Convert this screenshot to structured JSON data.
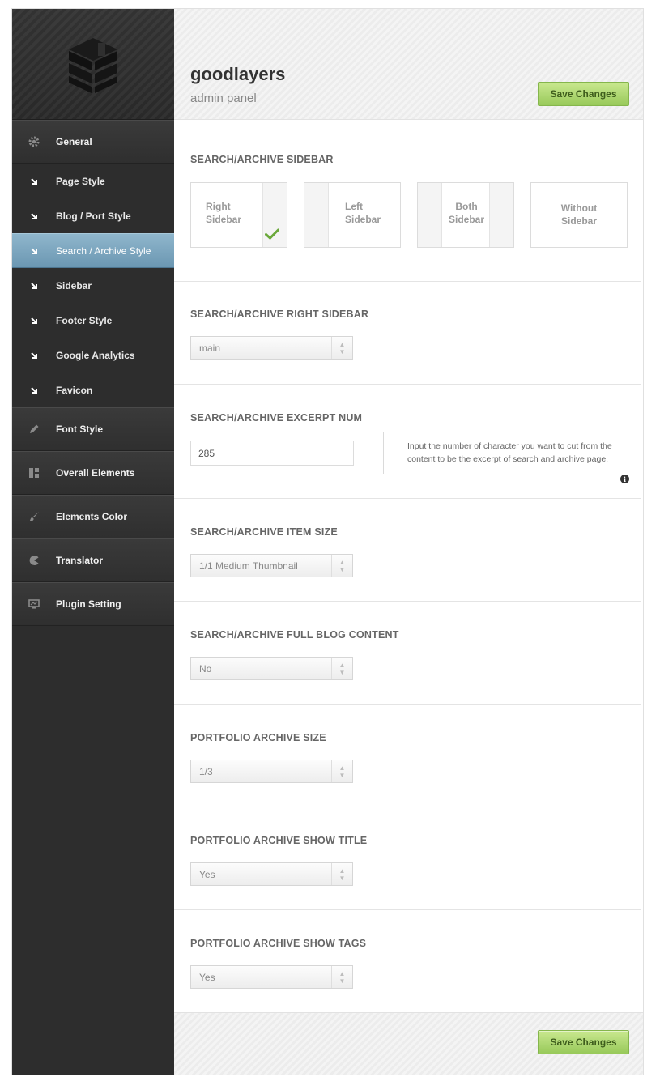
{
  "brand": {
    "name": "goodlayers",
    "subtitle": "admin panel"
  },
  "actions": {
    "save_label": "Save Changes"
  },
  "colors": {
    "accent_green": "#98c95a",
    "active_blue": "#7aa3bc",
    "sidebar_bg": "#2d2d2d"
  },
  "sidebar": {
    "logo_icon": "goodlayers-cube-logo",
    "general": {
      "label": "General",
      "icon": "gear-icon"
    },
    "sub_items": [
      {
        "label": "Page Style"
      },
      {
        "label": "Blog / Port Style"
      },
      {
        "label": "Search / Archive Style",
        "active": true
      },
      {
        "label": "Sidebar"
      },
      {
        "label": "Footer Style"
      },
      {
        "label": "Google Analytics"
      },
      {
        "label": "Favicon"
      }
    ],
    "main_items": [
      {
        "label": "Font Style",
        "icon": "pencil-icon"
      },
      {
        "label": "Overall Elements",
        "icon": "layout-grid-icon"
      },
      {
        "label": "Elements Color",
        "icon": "brush-icon"
      },
      {
        "label": "Translator",
        "icon": "pacman-icon"
      },
      {
        "label": "Plugin Setting",
        "icon": "monitor-icon"
      }
    ]
  },
  "sections": {
    "sidebar_layout": {
      "title": "SEARCH/ARCHIVE SIDEBAR",
      "options": [
        {
          "line1": "Right",
          "line2": "Sidebar",
          "selected": true
        },
        {
          "line1": "Left",
          "line2": "Sidebar"
        },
        {
          "line1": "Both",
          "line2": "Sidebar"
        },
        {
          "line1": "Without",
          "line2": "Sidebar"
        }
      ]
    },
    "right_sidebar": {
      "title": "SEARCH/ARCHIVE RIGHT SIDEBAR",
      "value": "main"
    },
    "excerpt_num": {
      "title": "SEARCH/ARCHIVE EXCERPT NUM",
      "value": "285",
      "description": "Input the number of character you want to cut from the content to be the excerpt of search and archive page."
    },
    "item_size": {
      "title": "SEARCH/ARCHIVE ITEM SIZE",
      "value": "1/1 Medium Thumbnail"
    },
    "full_blog_content": {
      "title": "SEARCH/ARCHIVE FULL BLOG CONTENT",
      "value": "No"
    },
    "portfolio_size": {
      "title": "PORTFOLIO ARCHIVE SIZE",
      "value": "1/3"
    },
    "portfolio_show_title": {
      "title": "PORTFOLIO ARCHIVE SHOW TITLE",
      "value": "Yes"
    },
    "portfolio_show_tags": {
      "title": "PORTFOLIO ARCHIVE SHOW TAGS",
      "value": "Yes"
    }
  }
}
